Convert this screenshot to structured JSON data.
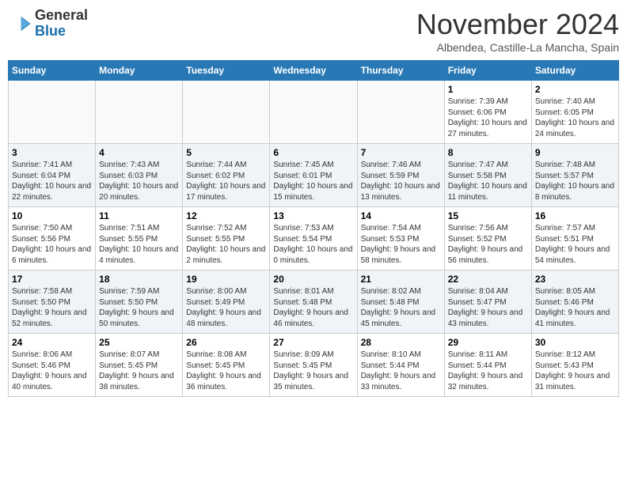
{
  "logo": {
    "general": "General",
    "blue": "Blue"
  },
  "title": "November 2024",
  "location": "Albendea, Castille-La Mancha, Spain",
  "days_of_week": [
    "Sunday",
    "Monday",
    "Tuesday",
    "Wednesday",
    "Thursday",
    "Friday",
    "Saturday"
  ],
  "weeks": [
    {
      "days": [
        {
          "number": "",
          "info": ""
        },
        {
          "number": "",
          "info": ""
        },
        {
          "number": "",
          "info": ""
        },
        {
          "number": "",
          "info": ""
        },
        {
          "number": "",
          "info": ""
        },
        {
          "number": "1",
          "info": "Sunrise: 7:39 AM\nSunset: 6:06 PM\nDaylight: 10 hours and 27 minutes."
        },
        {
          "number": "2",
          "info": "Sunrise: 7:40 AM\nSunset: 6:05 PM\nDaylight: 10 hours and 24 minutes."
        }
      ]
    },
    {
      "days": [
        {
          "number": "3",
          "info": "Sunrise: 7:41 AM\nSunset: 6:04 PM\nDaylight: 10 hours and 22 minutes."
        },
        {
          "number": "4",
          "info": "Sunrise: 7:43 AM\nSunset: 6:03 PM\nDaylight: 10 hours and 20 minutes."
        },
        {
          "number": "5",
          "info": "Sunrise: 7:44 AM\nSunset: 6:02 PM\nDaylight: 10 hours and 17 minutes."
        },
        {
          "number": "6",
          "info": "Sunrise: 7:45 AM\nSunset: 6:01 PM\nDaylight: 10 hours and 15 minutes."
        },
        {
          "number": "7",
          "info": "Sunrise: 7:46 AM\nSunset: 5:59 PM\nDaylight: 10 hours and 13 minutes."
        },
        {
          "number": "8",
          "info": "Sunrise: 7:47 AM\nSunset: 5:58 PM\nDaylight: 10 hours and 11 minutes."
        },
        {
          "number": "9",
          "info": "Sunrise: 7:48 AM\nSunset: 5:57 PM\nDaylight: 10 hours and 8 minutes."
        }
      ]
    },
    {
      "days": [
        {
          "number": "10",
          "info": "Sunrise: 7:50 AM\nSunset: 5:56 PM\nDaylight: 10 hours and 6 minutes."
        },
        {
          "number": "11",
          "info": "Sunrise: 7:51 AM\nSunset: 5:55 PM\nDaylight: 10 hours and 4 minutes."
        },
        {
          "number": "12",
          "info": "Sunrise: 7:52 AM\nSunset: 5:55 PM\nDaylight: 10 hours and 2 minutes."
        },
        {
          "number": "13",
          "info": "Sunrise: 7:53 AM\nSunset: 5:54 PM\nDaylight: 10 hours and 0 minutes."
        },
        {
          "number": "14",
          "info": "Sunrise: 7:54 AM\nSunset: 5:53 PM\nDaylight: 9 hours and 58 minutes."
        },
        {
          "number": "15",
          "info": "Sunrise: 7:56 AM\nSunset: 5:52 PM\nDaylight: 9 hours and 56 minutes."
        },
        {
          "number": "16",
          "info": "Sunrise: 7:57 AM\nSunset: 5:51 PM\nDaylight: 9 hours and 54 minutes."
        }
      ]
    },
    {
      "days": [
        {
          "number": "17",
          "info": "Sunrise: 7:58 AM\nSunset: 5:50 PM\nDaylight: 9 hours and 52 minutes."
        },
        {
          "number": "18",
          "info": "Sunrise: 7:59 AM\nSunset: 5:50 PM\nDaylight: 9 hours and 50 minutes."
        },
        {
          "number": "19",
          "info": "Sunrise: 8:00 AM\nSunset: 5:49 PM\nDaylight: 9 hours and 48 minutes."
        },
        {
          "number": "20",
          "info": "Sunrise: 8:01 AM\nSunset: 5:48 PM\nDaylight: 9 hours and 46 minutes."
        },
        {
          "number": "21",
          "info": "Sunrise: 8:02 AM\nSunset: 5:48 PM\nDaylight: 9 hours and 45 minutes."
        },
        {
          "number": "22",
          "info": "Sunrise: 8:04 AM\nSunset: 5:47 PM\nDaylight: 9 hours and 43 minutes."
        },
        {
          "number": "23",
          "info": "Sunrise: 8:05 AM\nSunset: 5:46 PM\nDaylight: 9 hours and 41 minutes."
        }
      ]
    },
    {
      "days": [
        {
          "number": "24",
          "info": "Sunrise: 8:06 AM\nSunset: 5:46 PM\nDaylight: 9 hours and 40 minutes."
        },
        {
          "number": "25",
          "info": "Sunrise: 8:07 AM\nSunset: 5:45 PM\nDaylight: 9 hours and 38 minutes."
        },
        {
          "number": "26",
          "info": "Sunrise: 8:08 AM\nSunset: 5:45 PM\nDaylight: 9 hours and 36 minutes."
        },
        {
          "number": "27",
          "info": "Sunrise: 8:09 AM\nSunset: 5:45 PM\nDaylight: 9 hours and 35 minutes."
        },
        {
          "number": "28",
          "info": "Sunrise: 8:10 AM\nSunset: 5:44 PM\nDaylight: 9 hours and 33 minutes."
        },
        {
          "number": "29",
          "info": "Sunrise: 8:11 AM\nSunset: 5:44 PM\nDaylight: 9 hours and 32 minutes."
        },
        {
          "number": "30",
          "info": "Sunrise: 8:12 AM\nSunset: 5:43 PM\nDaylight: 9 hours and 31 minutes."
        }
      ]
    }
  ]
}
